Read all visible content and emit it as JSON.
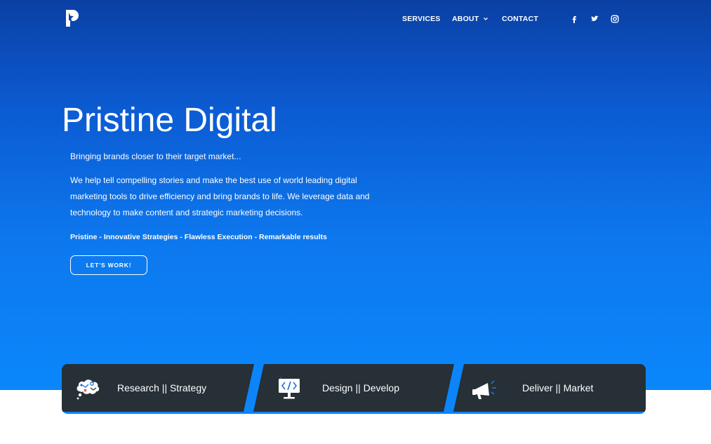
{
  "brand": {
    "logo_icon": "pristine-p-logo-icon"
  },
  "nav": {
    "items": [
      {
        "label": "SERVICES"
      },
      {
        "label": "ABOUT",
        "icon": "chevron-down-icon"
      },
      {
        "label": "CONTACT"
      }
    ],
    "social": [
      {
        "icon": "facebook-icon"
      },
      {
        "icon": "twitter-icon"
      },
      {
        "icon": "instagram-icon"
      }
    ]
  },
  "hero": {
    "title": "Pristine Digital",
    "tagline": "Bringing brands closer to their target market...",
    "description": "We help tell compelling stories and make the best use of world leading digital marketing tools to drive efficiency and bring brands to life. We leverage data and technology to make content and strategic marketing decisions.",
    "motto": "Pristine - Innovative Strategies - Flawless Execution - Remarkable results",
    "cta_label": "LET'S WORK!"
  },
  "features": [
    {
      "label": "Research || Strategy",
      "icon": "research-cloud-icon"
    },
    {
      "label": "Design || Develop",
      "icon": "code-monitor-icon"
    },
    {
      "label": "Deliver || Market",
      "icon": "megaphone-icon"
    }
  ],
  "colors": {
    "hero_top": "#0a40a4",
    "hero_bottom": "#0b87fb",
    "feature_bg": "#263036",
    "accent": "#0b85f9"
  }
}
